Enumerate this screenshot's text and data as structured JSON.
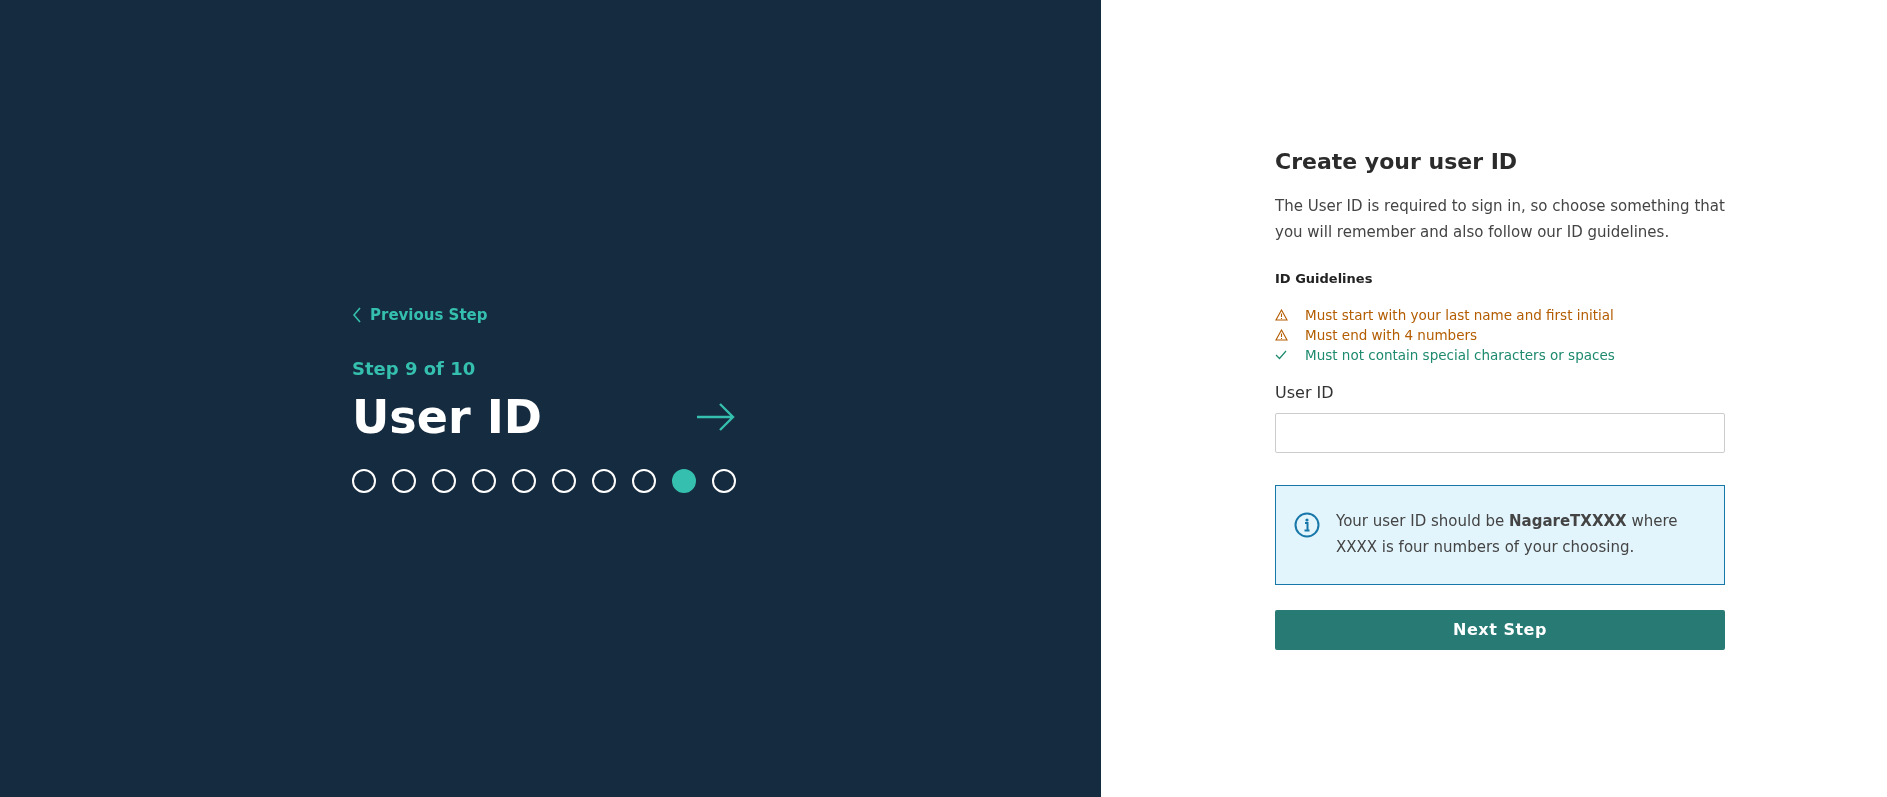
{
  "side_panel": {
    "back_link": "Previous Step",
    "step_label": "Step 9 of 10",
    "title": "User ID",
    "steps": [
      {
        "selected": false
      },
      {
        "selected": false
      },
      {
        "selected": false
      },
      {
        "selected": false
      },
      {
        "selected": false
      },
      {
        "selected": false
      },
      {
        "selected": false
      },
      {
        "selected": false
      },
      {
        "selected": true
      },
      {
        "selected": false
      }
    ]
  },
  "form": {
    "heading": "Create your user ID",
    "description": "The User ID is required to sign in, so choose something that you will remember and also follow our ID guidelines.",
    "guidelines_title": "ID Guidelines",
    "guidelines": [
      {
        "text": "Must start with your last name and first initial",
        "met": false
      },
      {
        "text": "Must end with 4 numbers",
        "met": false
      },
      {
        "text": "Must not contain special characters or spaces",
        "met": true
      }
    ],
    "field_label": "User ID",
    "info": "Your user ID should be **NagareTXXXX** where XXXX is four numbers of your choosing.",
    "submit": "Next Step"
  }
}
